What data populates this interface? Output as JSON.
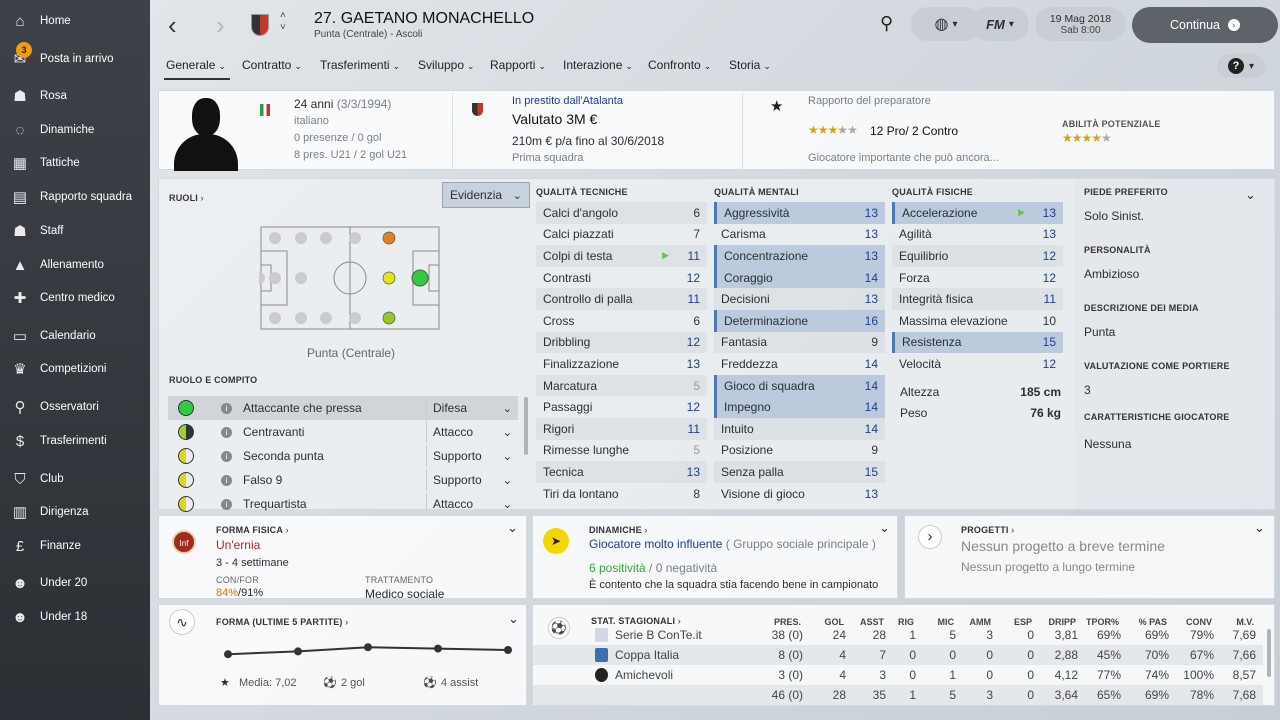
{
  "nav": [
    {
      "icon": "home-icon",
      "glyph": "⌂",
      "label": "Home"
    },
    {
      "icon": "inbox-icon",
      "glyph": "✉",
      "label": "Posta in arrivo",
      "badge": "3"
    },
    {
      "icon": "squad-icon",
      "glyph": "☗",
      "label": "Rosa"
    },
    {
      "icon": "dynamics-icon",
      "glyph": "◌",
      "label": "Dinamiche"
    },
    {
      "icon": "tactics-icon",
      "glyph": "▦",
      "label": "Tattiche"
    },
    {
      "icon": "squad-report-icon",
      "glyph": "▤",
      "label": "Rapporto squadra"
    },
    {
      "icon": "staff-icon",
      "glyph": "☗",
      "label": "Staff"
    },
    {
      "icon": "training-icon",
      "glyph": "▲",
      "label": "Allenamento"
    },
    {
      "icon": "medical-icon",
      "glyph": "✚",
      "label": "Centro medico"
    },
    {
      "icon": "calendar-icon",
      "glyph": "▭",
      "label": "Calendario"
    },
    {
      "icon": "trophy-icon",
      "glyph": "♛",
      "label": "Competizioni"
    },
    {
      "icon": "scouting-icon",
      "glyph": "⚲",
      "label": "Osservatori"
    },
    {
      "icon": "transfers-icon",
      "glyph": "$",
      "label": "Trasferimenti"
    },
    {
      "icon": "club-icon",
      "glyph": "⛉",
      "label": "Club"
    },
    {
      "icon": "board-icon",
      "glyph": "▥",
      "label": "Dirigenza"
    },
    {
      "icon": "finance-icon",
      "glyph": "£",
      "label": "Finanze"
    },
    {
      "icon": "u20-icon",
      "glyph": "☻",
      "label": "Under 20"
    },
    {
      "icon": "u18-icon",
      "glyph": "☻",
      "label": "Under 18"
    }
  ],
  "header": {
    "title": "27. GAETANO MONACHELLO",
    "subtitle": "Punta (Centrale) - Ascoli",
    "date": "19 Mag 2018",
    "day": "Sab 8:00",
    "continue": "Continua",
    "fm": "FM"
  },
  "tabs": [
    "Generale",
    "Contratto",
    "Trasferimenti",
    "Sviluppo",
    "Rapporti",
    "Interazione",
    "Confronto",
    "Storia"
  ],
  "profile": {
    "age": "24 anni",
    "dob": "(3/3/1994)",
    "nationality": "italiano",
    "apps": "0 presenze / 0 gol",
    "u21": "8 pres. U21 / 2 gol U21",
    "loan": "In prestito dall'Atalanta",
    "value": "Valutato 3M €",
    "wage": "210m € p/a fino al 30/6/2018",
    "team": "Prima squadra",
    "coach_report": "Rapporto del preparatore",
    "pros_cons": "12 Pro/ 2 Contro",
    "coach_note": "Giocatore importante che può ancora...",
    "potential_label": "ABILITÀ POTENZIALE",
    "current_stars": 3.5,
    "potential_stars": 4
  },
  "roles": {
    "label": "RUOLI",
    "dropdown": "Evidenzia",
    "position": "Punta (Centrale)",
    "role_label": "RUOLO E COMPITO",
    "rows": [
      {
        "name": "Attaccante che pressa",
        "duty": "Difesa",
        "color": "#2ecc40"
      },
      {
        "name": "Centravanti",
        "duty": "Attacco",
        "color": "#9bd12a"
      },
      {
        "name": "Seconda punta",
        "duty": "Supporto",
        "color": "#d8d820"
      },
      {
        "name": "Falso 9",
        "duty": "Supporto",
        "color": "#d8d820"
      },
      {
        "name": "Trequartista",
        "duty": "Attacco",
        "color": "#d8d820"
      }
    ]
  },
  "technical": {
    "title": "QUALITÀ TECNICHE",
    "rows": [
      {
        "n": "Calci d'angolo",
        "v": "6",
        "c": "dark"
      },
      {
        "n": "Calci piazzati",
        "v": "7",
        "c": "dark"
      },
      {
        "n": "Colpi di testa",
        "v": "11",
        "c": "blue",
        "arrow": true
      },
      {
        "n": "Contrasti",
        "v": "12",
        "c": "blue"
      },
      {
        "n": "Controllo di palla",
        "v": "11",
        "c": "blue"
      },
      {
        "n": "Cross",
        "v": "6",
        "c": "dark"
      },
      {
        "n": "Dribbling",
        "v": "12",
        "c": "blue"
      },
      {
        "n": "Finalizzazione",
        "v": "13",
        "c": "blue"
      },
      {
        "n": "Marcatura",
        "v": "5",
        "c": "gray"
      },
      {
        "n": "Passaggi",
        "v": "12",
        "c": "blue"
      },
      {
        "n": "Rigori",
        "v": "11",
        "c": "blue"
      },
      {
        "n": "Rimesse lunghe",
        "v": "5",
        "c": "gray"
      },
      {
        "n": "Tecnica",
        "v": "13",
        "c": "blue"
      },
      {
        "n": "Tiri da lontano",
        "v": "8",
        "c": "dark"
      }
    ]
  },
  "mental": {
    "title": "QUALITÀ MENTALI",
    "rows": [
      {
        "n": "Aggressività",
        "v": "13",
        "c": "blue",
        "hl": true
      },
      {
        "n": "Carisma",
        "v": "13",
        "c": "blue"
      },
      {
        "n": "Concentrazione",
        "v": "13",
        "c": "blue",
        "hl": true
      },
      {
        "n": "Coraggio",
        "v": "14",
        "c": "blue",
        "hl": true
      },
      {
        "n": "Decisioni",
        "v": "13",
        "c": "blue"
      },
      {
        "n": "Determinazione",
        "v": "16",
        "c": "blue",
        "hl": true
      },
      {
        "n": "Fantasia",
        "v": "9",
        "c": "dark"
      },
      {
        "n": "Freddezza",
        "v": "14",
        "c": "blue"
      },
      {
        "n": "Gioco di squadra",
        "v": "14",
        "c": "blue",
        "hl": true
      },
      {
        "n": "Impegno",
        "v": "14",
        "c": "blue",
        "hl": true
      },
      {
        "n": "Intuito",
        "v": "14",
        "c": "blue"
      },
      {
        "n": "Posizione",
        "v": "9",
        "c": "dark"
      },
      {
        "n": "Senza palla",
        "v": "15",
        "c": "blue"
      },
      {
        "n": "Visione di gioco",
        "v": "13",
        "c": "blue"
      }
    ]
  },
  "physical": {
    "title": "QUALITÀ FISICHE",
    "rows": [
      {
        "n": "Accelerazione",
        "v": "13",
        "c": "blue",
        "hl": true,
        "arrow": true
      },
      {
        "n": "Agilità",
        "v": "13",
        "c": "blue"
      },
      {
        "n": "Equilibrio",
        "v": "12",
        "c": "blue"
      },
      {
        "n": "Forza",
        "v": "12",
        "c": "blue"
      },
      {
        "n": "Integrità fisica",
        "v": "11",
        "c": "blue"
      },
      {
        "n": "Massima elevazione",
        "v": "10",
        "c": "dark"
      },
      {
        "n": "Resistenza",
        "v": "15",
        "c": "blue",
        "hl": true
      },
      {
        "n": "Velocità",
        "v": "12",
        "c": "blue"
      }
    ],
    "height_label": "Altezza",
    "height": "185 cm",
    "weight_label": "Peso",
    "weight": "76 kg"
  },
  "info": {
    "foot_label": "PIEDE PREFERITO",
    "foot": "Solo Sinist.",
    "personality_label": "PERSONALITÀ",
    "personality": "Ambizioso",
    "media_label": "DESCRIZIONE DEI MEDIA",
    "media": "Punta",
    "gk_label": "VALUTAZIONE COME PORTIERE",
    "gk": "3",
    "traits_label": "CARATTERISTICHE GIOCATORE",
    "traits": "Nessuna"
  },
  "fitness": {
    "title": "FORMA FISICA",
    "badge": "Inf",
    "status": "Un'ernia",
    "duration": "3 - 4 settimane",
    "cond_label": "CON/FOR",
    "cond": "84%",
    "sharp": "/91%",
    "treat_label": "TRATTAMENTO",
    "treatment": "Medico sociale"
  },
  "dynamics": {
    "title": "DINAMICHE",
    "influence": "Giocatore molto influente",
    "group": "( Gruppo sociale principale )",
    "positives": "6 positività",
    "sep": "/",
    "negatives": "0 negatività",
    "note": "È contento che la squadra stia facendo bene in campionato"
  },
  "projects": {
    "title": "PROGETTI",
    "short": "Nessun progetto a breve termine",
    "long": "Nessun progetto a lungo termine"
  },
  "form": {
    "title": "FORMA (ULTIME 5 PARTITE)",
    "avg": "Media: 7,02",
    "goals": "2 gol",
    "assists": "4 assist",
    "ratings": [
      7.2,
      7.4,
      7.7,
      7.6,
      7.5
    ]
  },
  "season": {
    "title": "STAT. STAGIONALI",
    "headers": [
      "PRES.",
      "GOL",
      "ASST",
      "RIG",
      "MIC",
      "AMM",
      "ESP",
      "DRIPP",
      "TPOR%",
      "% PAS",
      "CONV",
      "M.V."
    ],
    "rows": [
      {
        "comp": "Serie B ConTe.it",
        "vals": [
          "38 (0)",
          "24",
          "28",
          "1",
          "5",
          "3",
          "0",
          "3,81",
          "69%",
          "69%",
          "79%",
          "7,69"
        ]
      },
      {
        "comp": "Coppa Italia",
        "vals": [
          "8 (0)",
          "4",
          "7",
          "0",
          "0",
          "0",
          "0",
          "2,88",
          "45%",
          "70%",
          "67%",
          "7,66"
        ]
      },
      {
        "comp": "Amichevoli",
        "vals": [
          "3 (0)",
          "4",
          "3",
          "0",
          "1",
          "0",
          "0",
          "4,12",
          "77%",
          "74%",
          "100%",
          "8,57"
        ]
      },
      {
        "comp": "",
        "vals": [
          "46 (0)",
          "28",
          "35",
          "1",
          "5",
          "3",
          "0",
          "3,64",
          "65%",
          "69%",
          "78%",
          "7,68"
        ]
      }
    ]
  },
  "colors": {
    "accent": "#1e3d8f",
    "positive": "#3aa53a",
    "injury": "#b5261e",
    "cond": "#d4770c"
  }
}
